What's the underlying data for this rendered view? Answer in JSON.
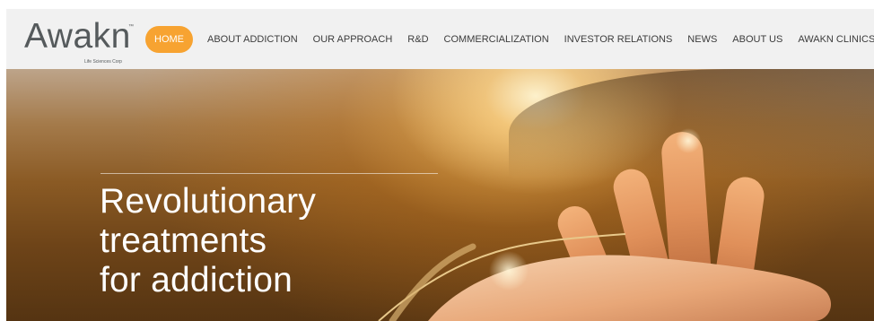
{
  "brand": {
    "name": "Awakn",
    "trademark": "™",
    "subtitle": "Life Sciences Corp"
  },
  "nav": {
    "items": [
      {
        "label": "HOME",
        "active": true
      },
      {
        "label": "ABOUT ADDICTION"
      },
      {
        "label": "OUR APPROACH"
      },
      {
        "label": "R&D"
      },
      {
        "label": "COMMERCIALIZATION"
      },
      {
        "label": "INVESTOR RELATIONS"
      },
      {
        "label": "NEWS"
      },
      {
        "label": "ABOUT US"
      },
      {
        "label": "AWAKN CLINICS"
      }
    ]
  },
  "hero": {
    "headline_lines": [
      "Revolutionary",
      "treatments",
      "for addiction"
    ]
  },
  "colors": {
    "accent": "#f7a331",
    "header_bg": "#f1f1f1",
    "nav_text": "#3c3c3c",
    "logo_text": "#555a5c"
  }
}
